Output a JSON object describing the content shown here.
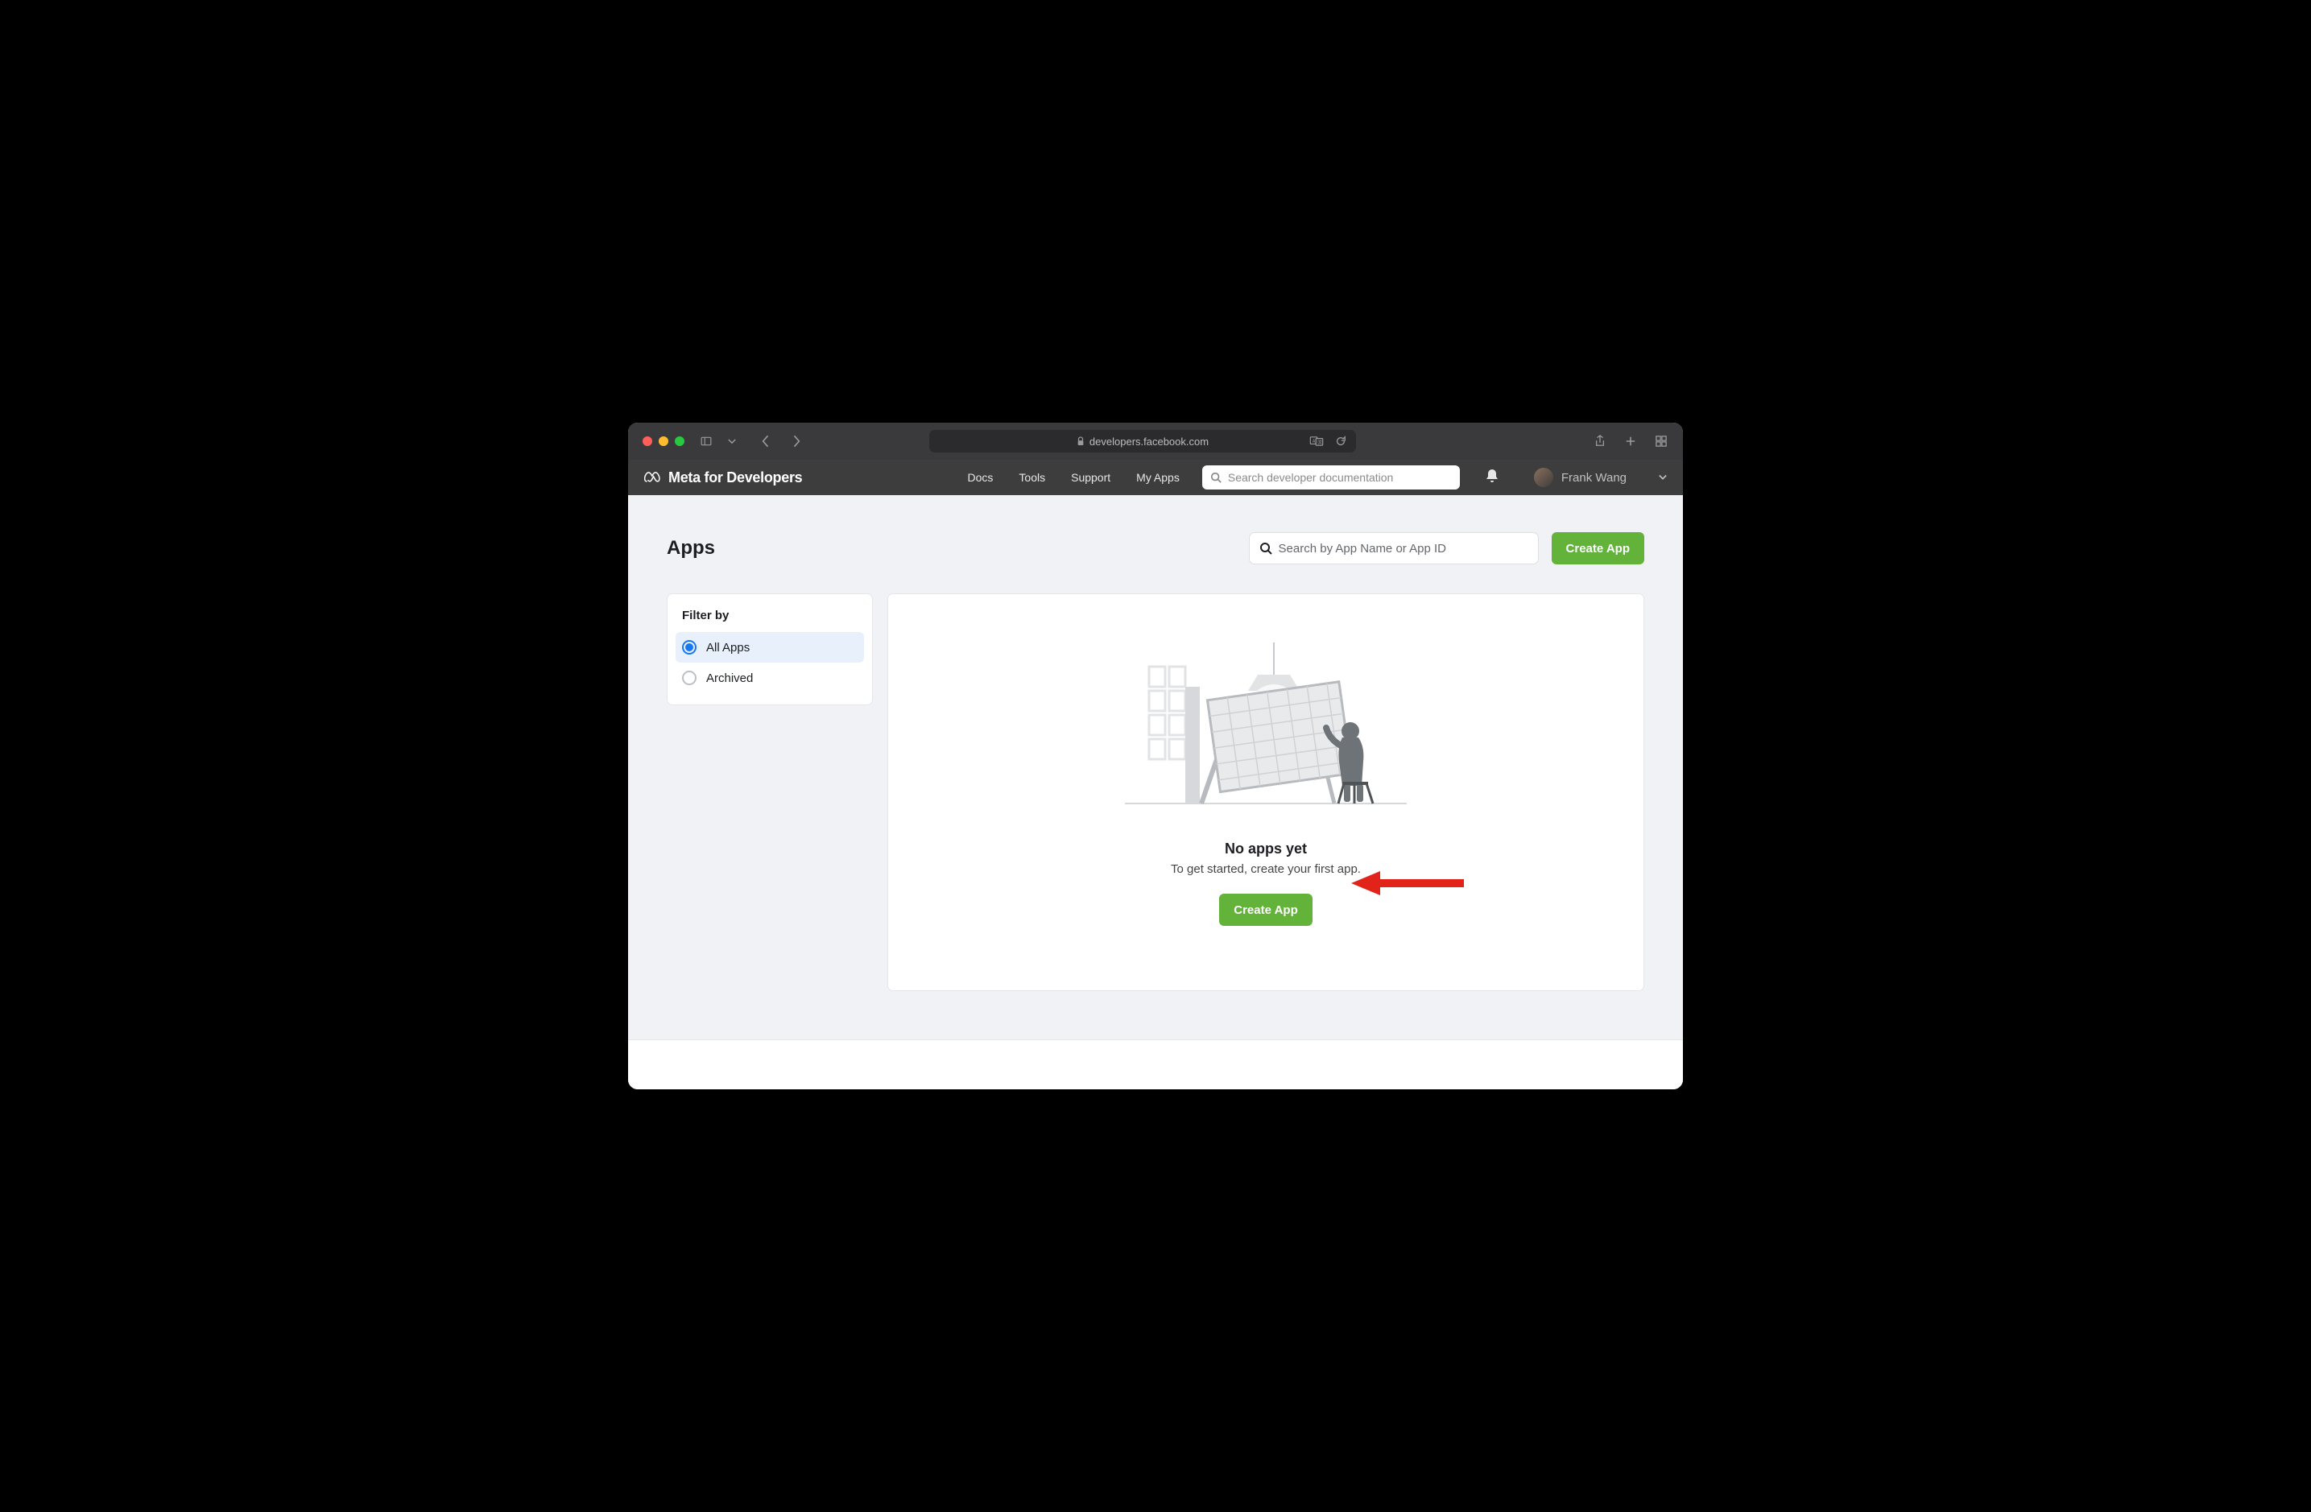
{
  "browser": {
    "url": "developers.facebook.com"
  },
  "header": {
    "brand": "Meta for Developers",
    "nav": {
      "docs": "Docs",
      "tools": "Tools",
      "support": "Support",
      "myapps": "My Apps"
    },
    "search_placeholder": "Search developer documentation",
    "username": "Frank Wang"
  },
  "page": {
    "title": "Apps",
    "app_search_placeholder": "Search by App Name or App ID",
    "create_app": "Create App"
  },
  "sidebar": {
    "title": "Filter by",
    "items": [
      {
        "label": "All Apps"
      },
      {
        "label": "Archived"
      }
    ]
  },
  "empty": {
    "title": "No apps yet",
    "subtitle": "To get started, create your first app.",
    "cta": "Create App"
  }
}
